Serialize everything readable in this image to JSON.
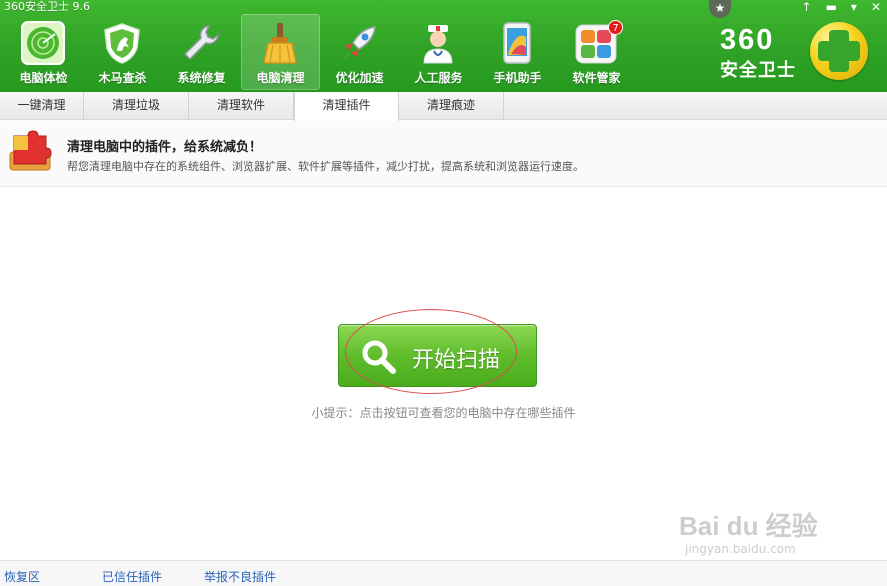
{
  "app": {
    "title": "360安全卫士 9.6"
  },
  "window_controls": [
    "↑",
    "▬",
    "▾",
    "✕"
  ],
  "nav": [
    {
      "label": "电脑体检",
      "icon": "radar-icon"
    },
    {
      "label": "木马查杀",
      "icon": "shield-horse-icon"
    },
    {
      "label": "系统修复",
      "icon": "wrench-icon"
    },
    {
      "label": "电脑清理",
      "icon": "broom-icon",
      "active": true
    },
    {
      "label": "优化加速",
      "icon": "rocket-icon"
    },
    {
      "label": "人工服务",
      "icon": "doctor-icon"
    },
    {
      "label": "手机助手",
      "icon": "phone-icon"
    },
    {
      "label": "软件管家",
      "icon": "app-grid-icon",
      "badge": "7"
    }
  ],
  "brand": {
    "number": "360",
    "name": "安全卫士"
  },
  "subtabs": [
    "一键清理",
    "清理垃圾",
    "清理软件",
    "清理插件",
    "清理痕迹"
  ],
  "active_subtab": "清理插件",
  "info": {
    "title": "清理电脑中的插件，给系统减负！",
    "desc": "帮您清理电脑中存在的系统组件、浏览器扩展、软件扩展等插件，减少打扰，提高系统和浏览器运行速度。"
  },
  "scan": {
    "label": "开始扫描",
    "hint": "小提示：点击按钮可查看您的电脑中存在哪些插件"
  },
  "footer": [
    "恢复区",
    "已信任插件",
    "举报不良插件"
  ],
  "watermark": {
    "main": "Bai du 经验",
    "sub": "jingyan.baidu.com"
  },
  "colors": {
    "header_green": "#2fa226",
    "accent_blue": "#2a62b8",
    "annotation_red": "#e04848"
  }
}
